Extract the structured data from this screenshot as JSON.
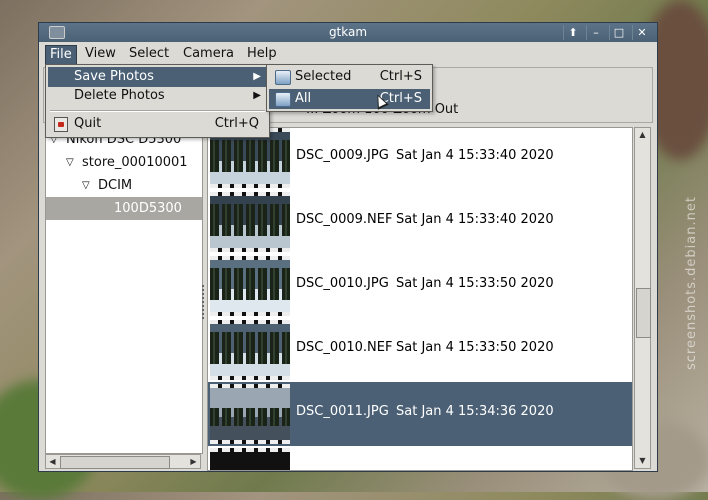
{
  "window": {
    "title": "gtkam"
  },
  "menubar": {
    "items": [
      {
        "label": "File",
        "active": true
      },
      {
        "label": "View"
      },
      {
        "label": "Select"
      },
      {
        "label": "Camera"
      },
      {
        "label": "Help"
      }
    ]
  },
  "file_menu": {
    "items": [
      {
        "label": "Save Photos",
        "submenu": true,
        "highlighted": true
      },
      {
        "label": "Delete Photos",
        "submenu": true
      },
      {
        "label": "Quit",
        "shortcut": "Ctrl+Q",
        "icon": "quit-icon"
      }
    ]
  },
  "save_submenu": {
    "items": [
      {
        "label": "Selected",
        "shortcut": "Ctrl+S",
        "icon": "save-selected-icon"
      },
      {
        "label": "All",
        "shortcut": "Ctrl+S",
        "icon": "save-all-icon",
        "highlighted": true
      }
    ]
  },
  "toolbar": {
    "partial_text": "... Zoom 100 Zoom Out"
  },
  "tree": {
    "items": [
      {
        "label": "Nikon DSC D5300",
        "level": 0,
        "expanded": true
      },
      {
        "label": "store_00010001",
        "level": 1,
        "expanded": true
      },
      {
        "label": "DCIM",
        "level": 2,
        "expanded": true
      },
      {
        "label": "100D5300",
        "level": 3,
        "selected": true
      }
    ]
  },
  "files": [
    {
      "name": "DSC_0009.JPG",
      "date": "Sat Jan  4 15:33:40 2020"
    },
    {
      "name": "DSC_0009.NEF",
      "date": "Sat Jan  4 15:33:40 2020"
    },
    {
      "name": "DSC_0010.JPG",
      "date": "Sat Jan  4 15:33:50 2020"
    },
    {
      "name": "DSC_0010.NEF",
      "date": "Sat Jan  4 15:33:50 2020"
    },
    {
      "name": "DSC_0011.JPG",
      "date": "Sat Jan  4 15:34:36 2020",
      "selected": true
    }
  ],
  "watermark": "screenshots.debian.net",
  "colors": {
    "selection": "#4b6075",
    "titlebar": "#5d7389"
  }
}
